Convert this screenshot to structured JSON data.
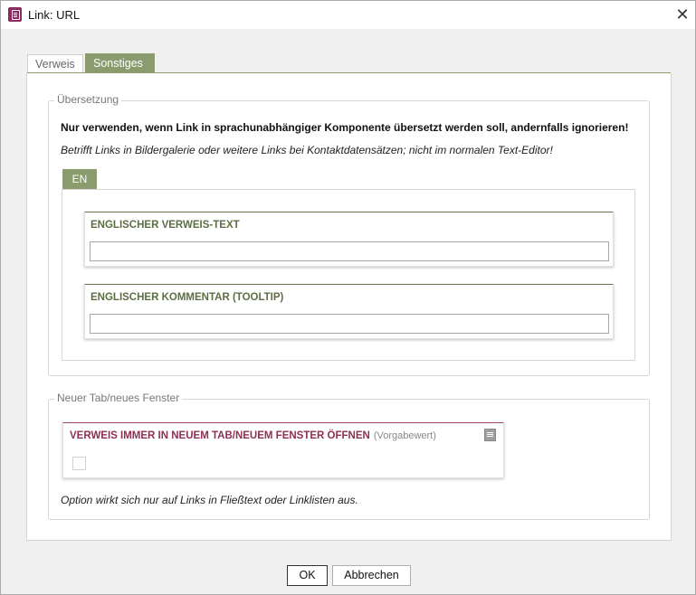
{
  "window": {
    "title": "Link: URL",
    "close_icon": "close-icon",
    "app_icon": "document-link-icon"
  },
  "tabs": [
    {
      "label": "Verweis",
      "active": false
    },
    {
      "label": "Sonstiges",
      "active": true
    }
  ],
  "translation": {
    "legend": "Übersetzung",
    "note_bold": "Nur verwenden, wenn Link in sprachunabhängiger Komponente übersetzt werden soll, andernfalls ignorieren!",
    "note_italic": "Betrifft Links in Bildergalerie oder weitere Links bei Kontaktdatensätzen; nicht im normalen Text-Editor!",
    "lang_tab": "EN",
    "fields": [
      {
        "label": "ENGLISCHER VERWEIS-TEXT",
        "value": ""
      },
      {
        "label": "ENGLISCHER KOMMENTAR (TOOLTIP)",
        "value": ""
      }
    ]
  },
  "new_window": {
    "legend": "Neuer Tab/neues Fenster",
    "checkbox_label": "VERWEIS IMMER IN NEUEM TAB/NEUEM FENSTER ÖFFNEN",
    "default_hint": "(Vorgabewert)",
    "checked": false,
    "note": "Option wirkt sich nur auf Links in Fließtext oder Linklisten aus."
  },
  "buttons": {
    "ok": "OK",
    "cancel": "Abbrechen"
  },
  "colors": {
    "accent_green": "#8a9b6e",
    "label_green": "#5e6e44",
    "label_red": "#8e2f55"
  }
}
